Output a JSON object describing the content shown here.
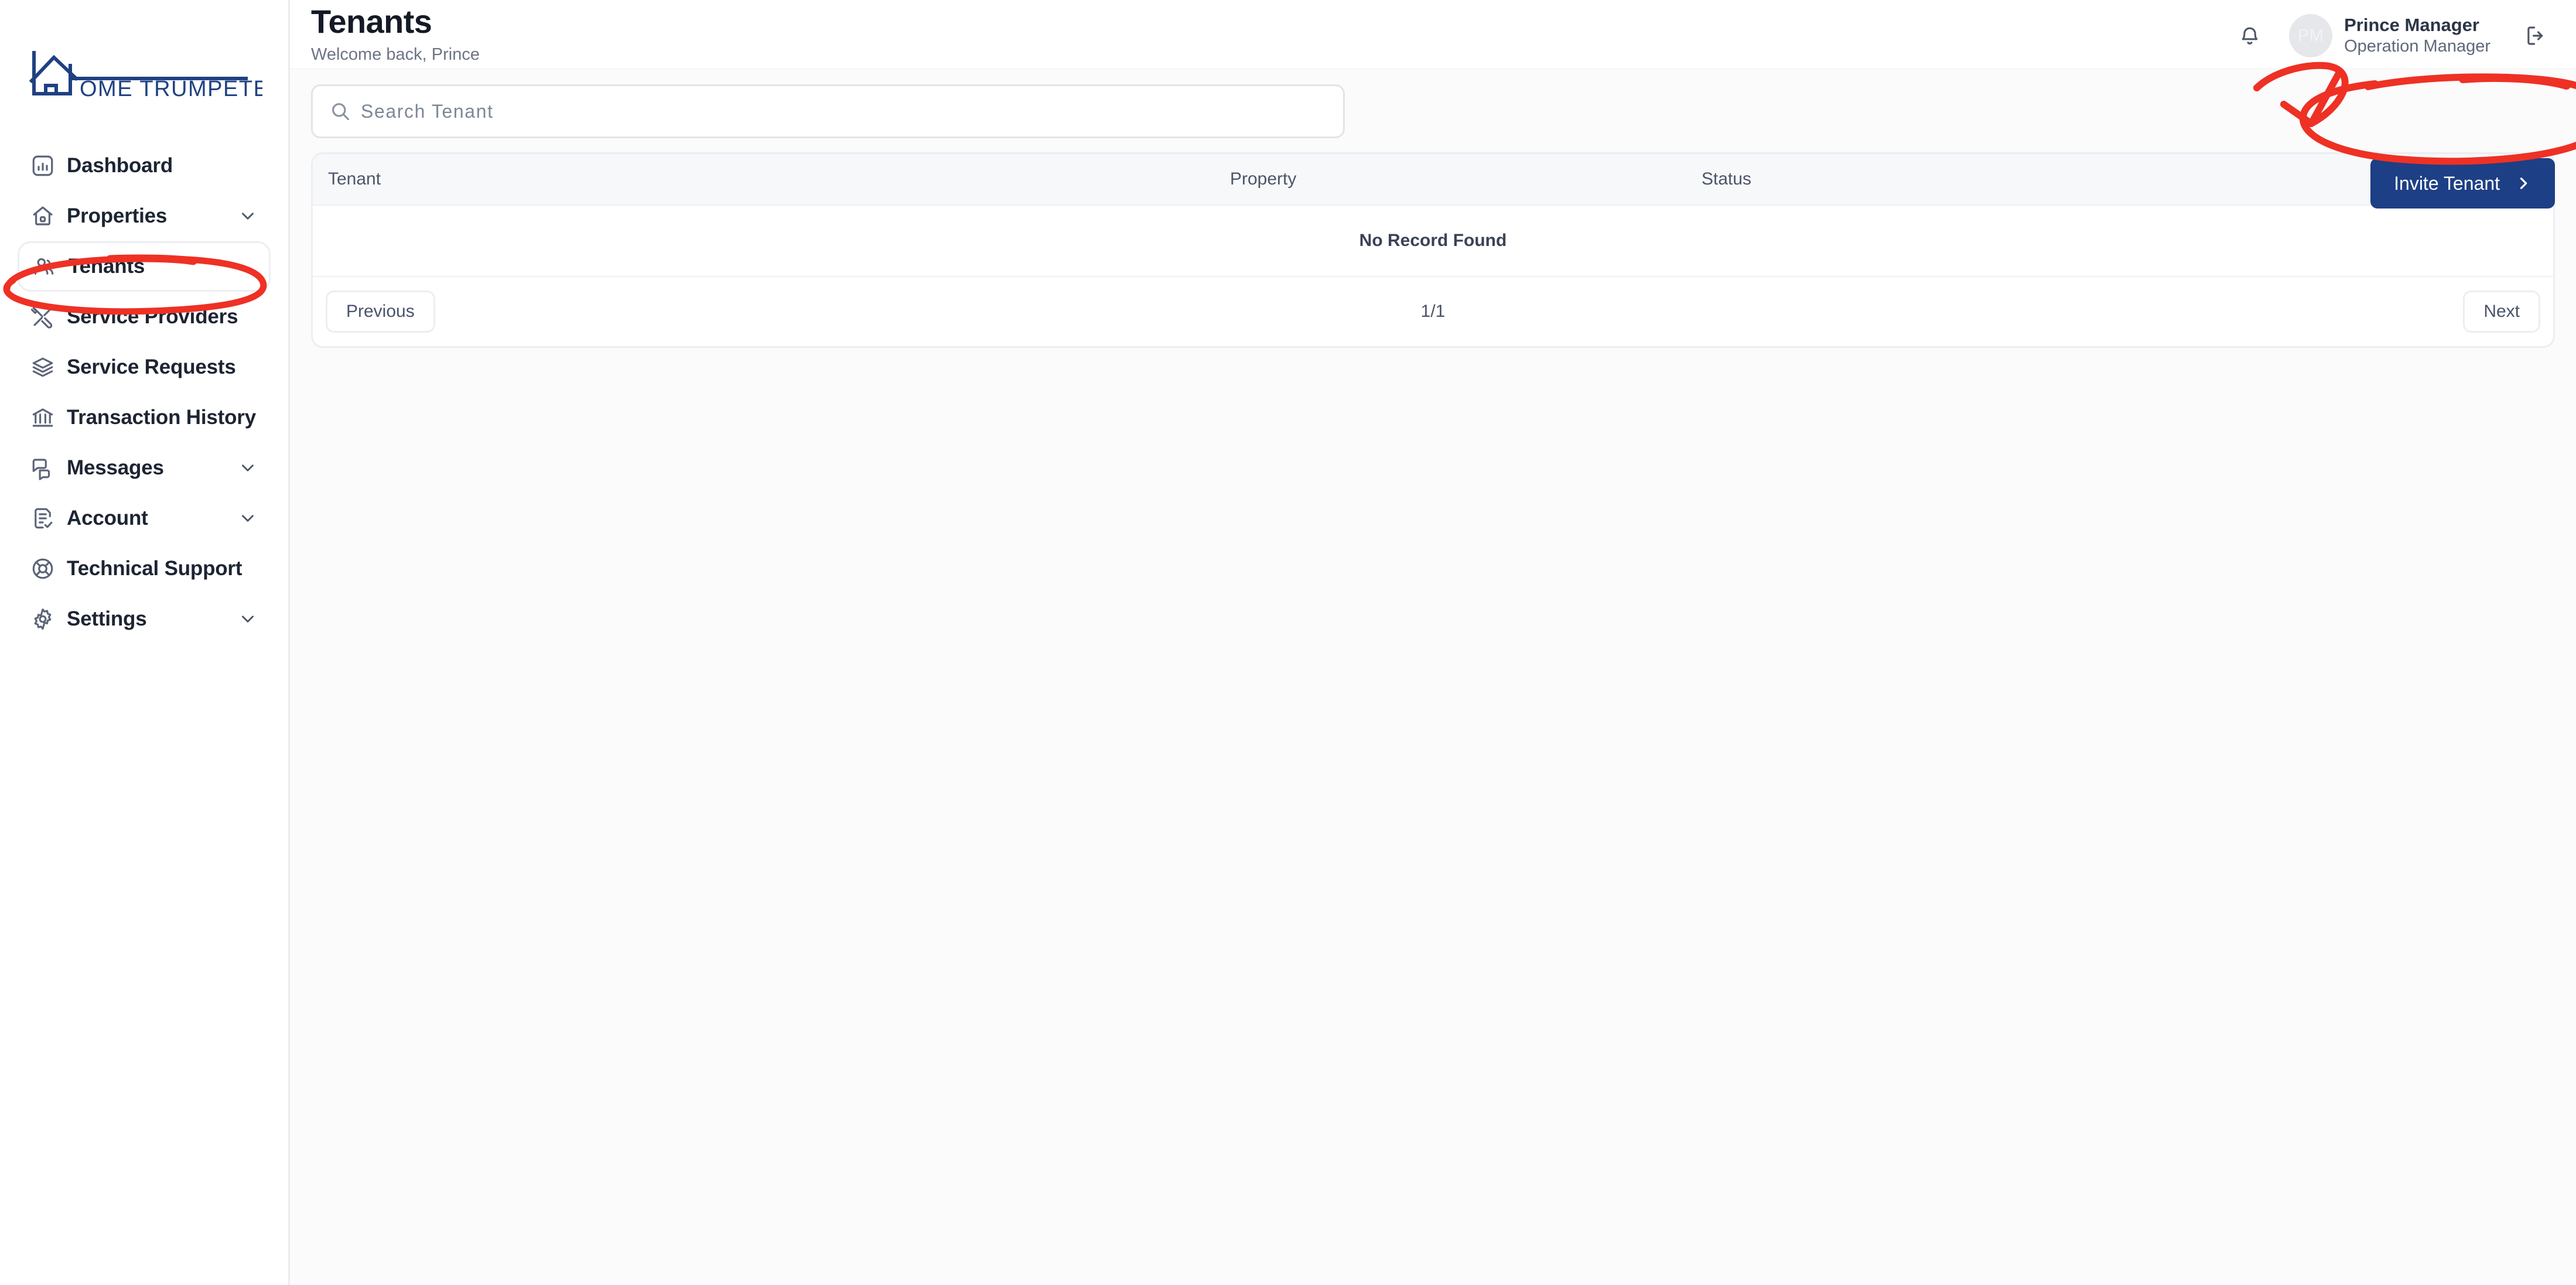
{
  "brand": {
    "logo_text": "OME TRUMPETER",
    "logo_full_name": "HOME TRUMPETER",
    "logo_color": "#1f4182"
  },
  "sidebar": {
    "items": [
      {
        "label": "Dashboard",
        "icon": "chart-bar-icon",
        "expandable": false,
        "active": false
      },
      {
        "label": "Properties",
        "icon": "home-icon",
        "expandable": true,
        "active": false
      },
      {
        "label": "Tenants",
        "icon": "users-icon",
        "expandable": false,
        "active": true
      },
      {
        "label": "Service Providers",
        "icon": "tools-icon",
        "expandable": false,
        "active": false
      },
      {
        "label": "Service Requests",
        "icon": "layers-icon",
        "expandable": false,
        "active": false
      },
      {
        "label": "Transaction History",
        "icon": "bank-icon",
        "expandable": false,
        "active": false
      },
      {
        "label": "Messages",
        "icon": "chat-icon",
        "expandable": true,
        "active": false
      },
      {
        "label": "Account",
        "icon": "document-check-icon",
        "expandable": true,
        "active": false
      },
      {
        "label": "Technical Support",
        "icon": "lifebuoy-icon",
        "expandable": false,
        "active": false
      },
      {
        "label": "Settings",
        "icon": "gear-icon",
        "expandable": true,
        "active": false
      }
    ]
  },
  "header": {
    "title": "Tenants",
    "subtitle": "Welcome back, Prince",
    "notification_icon": "bell-icon",
    "logout_icon": "logout-icon",
    "user": {
      "initials": "PM",
      "name": "Prince Manager",
      "role": "Operation Manager"
    }
  },
  "search": {
    "placeholder": "Search Tenant",
    "value": "",
    "icon": "search-icon"
  },
  "actions": {
    "invite_label": "Invite Tenant",
    "invite_chevron": "chevron-right-icon",
    "invite_color": "#1d3f85"
  },
  "table": {
    "columns": [
      "Tenant",
      "Property",
      "Status"
    ],
    "rows": [],
    "empty_message": "No Record Found"
  },
  "pagination": {
    "previous_label": "Previous",
    "next_label": "Next",
    "page_indicator": "1/1"
  },
  "annotations": {
    "color": "#ee3124",
    "shapes": [
      {
        "type": "ellipse",
        "target": "sidebar-item-tenants"
      },
      {
        "type": "ellipse",
        "target": "invite-tenant-button"
      },
      {
        "type": "arrow",
        "target": "invite-tenant-button"
      }
    ]
  }
}
